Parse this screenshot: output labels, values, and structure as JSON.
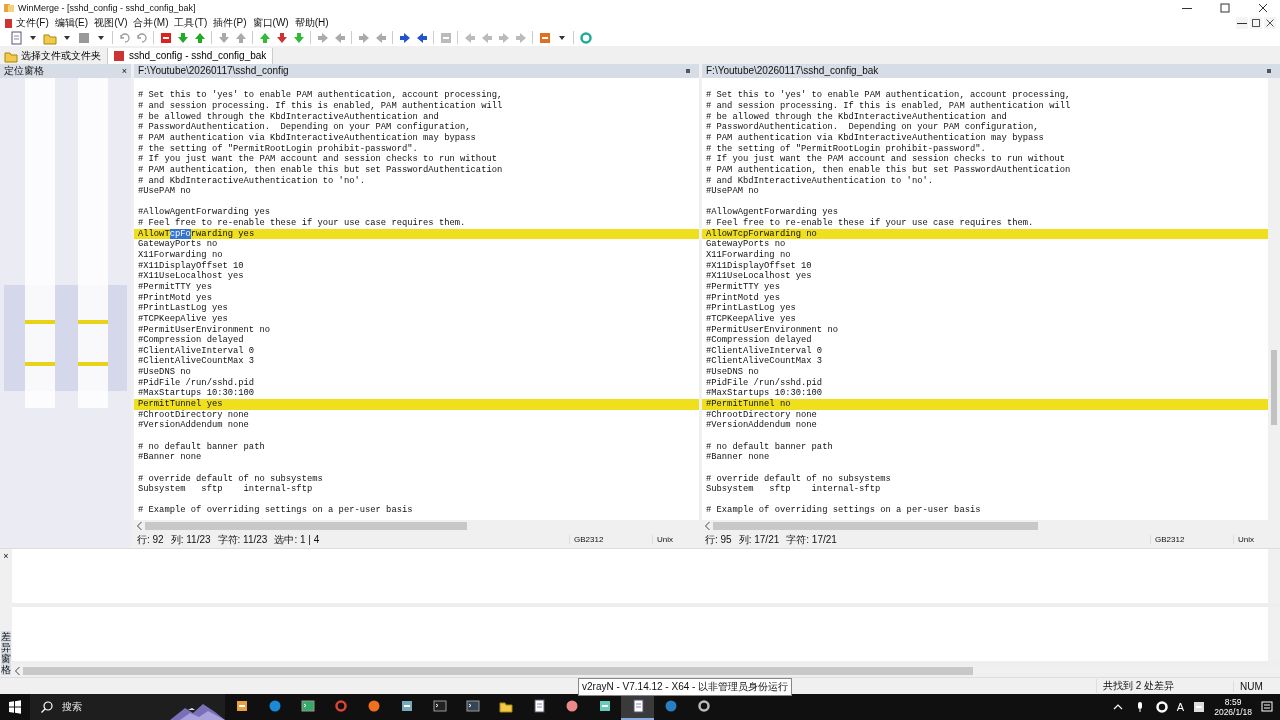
{
  "window": {
    "title": "WinMerge - [sshd_config - sshd_config_bak]"
  },
  "menu": [
    "文件(F)",
    "编辑(E)",
    "视图(V)",
    "合并(M)",
    "工具(T)",
    "插件(P)",
    "窗口(W)",
    "帮助(H)"
  ],
  "tabs": [
    {
      "label": "选择文件或文件夹",
      "selected": false
    },
    {
      "label": "sshd_config - sshd_config_bak",
      "selected": true
    }
  ],
  "location_pane": {
    "title": "定位窗格",
    "close": "×"
  },
  "panes": [
    {
      "path": "F:\\Youtube\\20260117\\sshd_config",
      "lines": [
        {
          "diff": false
        },
        {
          "text": "# Set this to 'yes' to enable PAM authentication, account processing,",
          "diff": false
        },
        {
          "text": "# and session processing. If this is enabled, PAM authentication will",
          "diff": false
        },
        {
          "text": "# be allowed through the KbdInteractiveAuthentication and",
          "diff": false
        },
        {
          "text": "# PasswordAuthentication.  Depending on your PAM configuration,",
          "diff": false
        },
        {
          "text": "# PAM authentication via KbdInteractiveAuthentication may bypass",
          "diff": false
        },
        {
          "text": "# the setting of \"PermitRootLogin prohibit-password\".",
          "diff": false
        },
        {
          "text": "# If you just want the PAM account and session checks to run without",
          "diff": false
        },
        {
          "text": "# PAM authentication, then enable this but set PasswordAuthentication",
          "diff": false
        },
        {
          "text": "# and KbdInteractiveAuthentication to 'no'.",
          "diff": false
        },
        {
          "text": "#UsePAM no",
          "diff": false
        },
        {
          "diff": false
        },
        {
          "text": "#AllowAgentForwarding yes",
          "diff": false
        },
        {
          "text": "# Feel free to re-enable these if your use case requires them.",
          "diff": false
        },
        {
          "segments": [
            {
              "text": "AllowT",
              "selected": false
            },
            {
              "text": "cpFo",
              "selected": true
            },
            {
              "text": "rwarding yes",
              "selected": false
            }
          ],
          "diff": true
        },
        {
          "text": "GatewayPorts no",
          "diff": false
        },
        {
          "text": "X11Forwarding no",
          "diff": false
        },
        {
          "text": "#X11DisplayOffset 10",
          "diff": false
        },
        {
          "text": "#X11UseLocalhost yes",
          "diff": false
        },
        {
          "text": "#PermitTTY yes",
          "diff": false
        },
        {
          "text": "#PrintMotd yes",
          "diff": false
        },
        {
          "text": "#PrintLastLog yes",
          "diff": false
        },
        {
          "text": "#TCPKeepAlive yes",
          "diff": false
        },
        {
          "text": "#PermitUserEnvironment no",
          "diff": false
        },
        {
          "text": "#Compression delayed",
          "diff": false
        },
        {
          "text": "#ClientAliveInterval 0",
          "diff": false
        },
        {
          "text": "#ClientAliveCountMax 3",
          "diff": false
        },
        {
          "text": "#UseDNS no",
          "diff": false
        },
        {
          "text": "#PidFile /run/sshd.pid",
          "diff": false
        },
        {
          "text": "#MaxStartups 10:30:100",
          "diff": false
        },
        {
          "text": "PermitTunnel yes",
          "diff": true
        },
        {
          "text": "#ChrootDirectory none",
          "diff": false
        },
        {
          "text": "#VersionAddendum none",
          "diff": false
        },
        {
          "diff": false
        },
        {
          "text": "# no default banner path",
          "diff": false
        },
        {
          "text": "#Banner none",
          "diff": false
        },
        {
          "diff": false
        },
        {
          "text": "# override default of no subsystems",
          "diff": false
        },
        {
          "text": "Subsystem   sftp    internal-sftp",
          "diff": false
        },
        {
          "diff": false
        },
        {
          "text": "# Example of overriding settings on a per-user basis",
          "diff": false
        }
      ],
      "status": {
        "items": [
          "行: 92",
          "列: 11/23",
          "字符: 11/23",
          "选中: 1 | 4"
        ],
        "encoding": "GB2312",
        "eol": "Unix"
      }
    },
    {
      "path": "F:\\Youtube\\20260117\\sshd_config_bak",
      "lines": [
        {
          "diff": false
        },
        {
          "text": "# Set this to 'yes' to enable PAM authentication, account processing,",
          "diff": false
        },
        {
          "text": "# and session processing. If this is enabled, PAM authentication will",
          "diff": false
        },
        {
          "text": "# be allowed through the KbdInteractiveAuthentication and",
          "diff": false
        },
        {
          "text": "# PasswordAuthentication.  Depending on your PAM configuration,",
          "diff": false
        },
        {
          "text": "# PAM authentication via KbdInteractiveAuthentication may bypass",
          "diff": false
        },
        {
          "text": "# the setting of \"PermitRootLogin prohibit-password\".",
          "diff": false
        },
        {
          "text": "# If you just want the PAM account and session checks to run without",
          "diff": false
        },
        {
          "text": "# PAM authentication, then enable this but set PasswordAuthentication",
          "diff": false
        },
        {
          "text": "# and KbdInteractiveAuthentication to 'no'.",
          "diff": false
        },
        {
          "text": "#UsePAM no",
          "diff": false
        },
        {
          "diff": false
        },
        {
          "text": "#AllowAgentForwarding yes",
          "diff": false
        },
        {
          "text": "# Feel free to re-enable these if your use case requires them.",
          "diff": false
        },
        {
          "text": "AllowTcpForwarding no",
          "diff": true
        },
        {
          "text": "GatewayPorts no",
          "diff": false
        },
        {
          "text": "X11Forwarding no",
          "diff": false
        },
        {
          "text": "#X11DisplayOffset 10",
          "diff": false
        },
        {
          "text": "#X11UseLocalhost yes",
          "diff": false
        },
        {
          "text": "#PermitTTY yes",
          "diff": false
        },
        {
          "text": "#PrintMotd yes",
          "diff": false
        },
        {
          "text": "#PrintLastLog yes",
          "diff": false
        },
        {
          "text": "#TCPKeepAlive yes",
          "diff": false
        },
        {
          "text": "#PermitUserEnvironment no",
          "diff": false
        },
        {
          "text": "#Compression delayed",
          "diff": false
        },
        {
          "text": "#ClientAliveInterval 0",
          "diff": false
        },
        {
          "text": "#ClientAliveCountMax 3",
          "diff": false
        },
        {
          "text": "#UseDNS no",
          "diff": false
        },
        {
          "text": "#PidFile /run/sshd.pid",
          "diff": false
        },
        {
          "text": "#MaxStartups 10:30:100",
          "diff": false
        },
        {
          "text": "#PermitTunnel no",
          "diff": true
        },
        {
          "text": "#ChrootDirectory none",
          "diff": false
        },
        {
          "text": "#VersionAddendum none",
          "diff": false
        },
        {
          "diff": false
        },
        {
          "text": "# no default banner path",
          "diff": false
        },
        {
          "text": "#Banner none",
          "diff": false
        },
        {
          "diff": false
        },
        {
          "text": "# override default of no subsystems",
          "diff": false
        },
        {
          "text": "Subsystem   sftp    internal-sftp",
          "diff": false
        },
        {
          "diff": false
        },
        {
          "text": "# Example of overriding settings on a per-user basis",
          "diff": false
        }
      ],
      "status": {
        "items": [
          "行: 95",
          "列: 17/21",
          "字符: 17/21"
        ],
        "encoding": "GB2312",
        "eol": "Unix"
      }
    }
  ],
  "diff_pane": {
    "title": "差异窗格",
    "close": "×"
  },
  "status_bar": {
    "message": "共找到 2 处差异",
    "num": "NUM"
  },
  "tooltip": "v2rayN - V7.14.12 - X64 - 以非管理员身份运行",
  "taskbar": {
    "search_placeholder": "搜索",
    "ime": "A",
    "time": "8:59",
    "date": "2026/1/18"
  }
}
